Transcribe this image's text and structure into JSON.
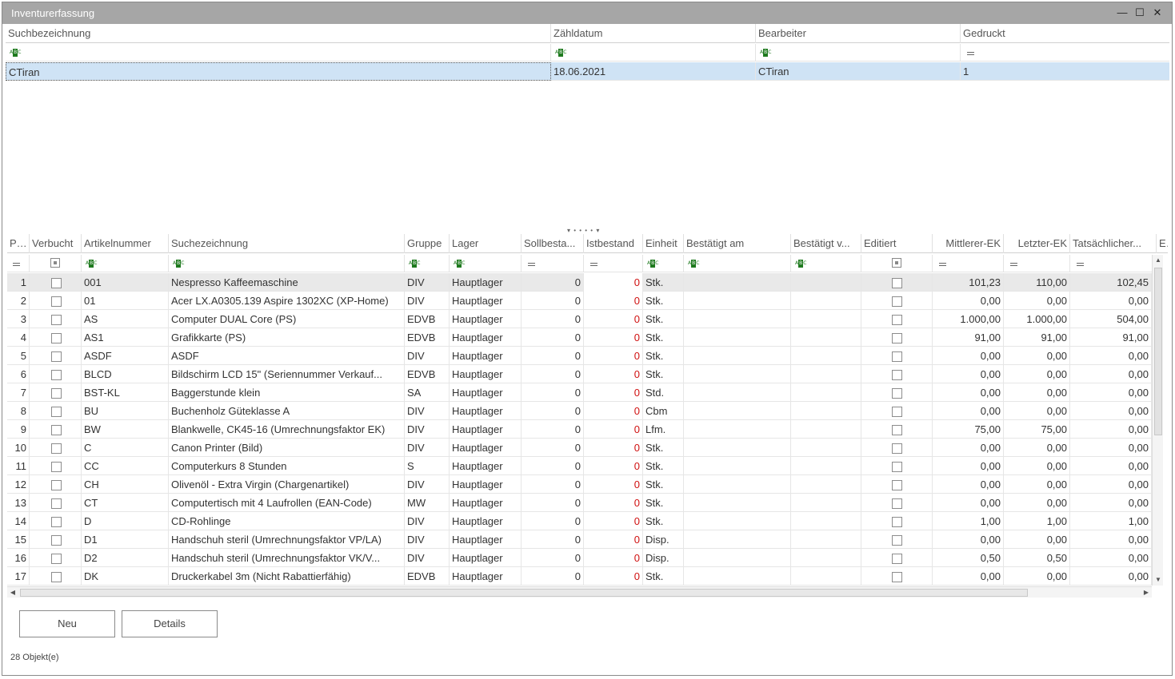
{
  "window": {
    "title": "Inventurerfassung",
    "minimize_glyph": "—",
    "maximize_glyph": "☐",
    "close_glyph": "✕"
  },
  "top_grid": {
    "columns": [
      "Suchbezeichnung",
      "Zähldatum",
      "Bearbeiter",
      "Gedruckt"
    ],
    "rows": [
      {
        "suchbezeichnung": "CTiran",
        "zaehldatum": "18.06.2021",
        "bearbeiter": "CTiran",
        "gedruckt": "1"
      }
    ]
  },
  "splitter_glyph": "▾ • • • • ▾",
  "bottom_grid": {
    "columns": [
      "Pos",
      "Verbucht",
      "Artikelnummer",
      "Suchezeichnung",
      "Gruppe",
      "Lager",
      "Sollbesta...",
      "Istbestand",
      "Einheit",
      "Bestätigt am",
      "Bestätigt v...",
      "Editiert",
      "Mittlerer-EK",
      "Letzter-EK",
      "Tatsächlicher...",
      "E"
    ],
    "rows": [
      {
        "pos": "1",
        "art": "001",
        "such": "Nespresso Kaffeemaschine",
        "gruppe": "DIV",
        "lager": "Hauptlager",
        "soll": "0",
        "ist": "0",
        "einheit": "Stk.",
        "mek": "101,23",
        "lek": "110,00",
        "tek": "102,45"
      },
      {
        "pos": "2",
        "art": "01",
        "such": "Acer LX.A0305.139 Aspire 1302XC (XP-Home)",
        "gruppe": "DIV",
        "lager": "Hauptlager",
        "soll": "0",
        "ist": "0",
        "einheit": "Stk.",
        "mek": "0,00",
        "lek": "0,00",
        "tek": "0,00"
      },
      {
        "pos": "3",
        "art": "AS",
        "such": "Computer DUAL Core (PS)",
        "gruppe": "EDVB",
        "lager": "Hauptlager",
        "soll": "0",
        "ist": "0",
        "einheit": "Stk.",
        "mek": "1.000,00",
        "lek": "1.000,00",
        "tek": "504,00"
      },
      {
        "pos": "4",
        "art": "AS1",
        "such": "Grafikkarte (PS)",
        "gruppe": "EDVB",
        "lager": "Hauptlager",
        "soll": "0",
        "ist": "0",
        "einheit": "Stk.",
        "mek": "91,00",
        "lek": "91,00",
        "tek": "91,00"
      },
      {
        "pos": "5",
        "art": "ASDF",
        "such": "ASDF",
        "gruppe": "DIV",
        "lager": "Hauptlager",
        "soll": "0",
        "ist": "0",
        "einheit": "Stk.",
        "mek": "0,00",
        "lek": "0,00",
        "tek": "0,00"
      },
      {
        "pos": "6",
        "art": "BLCD",
        "such": "Bildschirm LCD 15\" (Seriennummer Verkauf...",
        "gruppe": "EDVB",
        "lager": "Hauptlager",
        "soll": "0",
        "ist": "0",
        "einheit": "Stk.",
        "mek": "0,00",
        "lek": "0,00",
        "tek": "0,00"
      },
      {
        "pos": "7",
        "art": "BST-KL",
        "such": "Baggerstunde klein",
        "gruppe": "SA",
        "lager": "Hauptlager",
        "soll": "0",
        "ist": "0",
        "einheit": "Std.",
        "mek": "0,00",
        "lek": "0,00",
        "tek": "0,00"
      },
      {
        "pos": "8",
        "art": "BU",
        "such": "Buchenholz Güteklasse A",
        "gruppe": "DIV",
        "lager": "Hauptlager",
        "soll": "0",
        "ist": "0",
        "einheit": "Cbm",
        "mek": "0,00",
        "lek": "0,00",
        "tek": "0,00"
      },
      {
        "pos": "9",
        "art": "BW",
        "such": "Blankwelle, CK45-16 (Umrechnungsfaktor EK)",
        "gruppe": "DIV",
        "lager": "Hauptlager",
        "soll": "0",
        "ist": "0",
        "einheit": "Lfm.",
        "mek": "75,00",
        "lek": "75,00",
        "tek": "0,00"
      },
      {
        "pos": "10",
        "art": "C",
        "such": "Canon Printer (Bild)",
        "gruppe": "DIV",
        "lager": "Hauptlager",
        "soll": "0",
        "ist": "0",
        "einheit": "Stk.",
        "mek": "0,00",
        "lek": "0,00",
        "tek": "0,00"
      },
      {
        "pos": "11",
        "art": "CC",
        "such": "Computerkurs 8 Stunden",
        "gruppe": "S",
        "lager": "Hauptlager",
        "soll": "0",
        "ist": "0",
        "einheit": "Stk.",
        "mek": "0,00",
        "lek": "0,00",
        "tek": "0,00"
      },
      {
        "pos": "12",
        "art": "CH",
        "such": "Olivenöl - Extra Virgin (Chargenartikel)",
        "gruppe": "DIV",
        "lager": "Hauptlager",
        "soll": "0",
        "ist": "0",
        "einheit": "Stk.",
        "mek": "0,00",
        "lek": "0,00",
        "tek": "0,00"
      },
      {
        "pos": "13",
        "art": "CT",
        "such": "Computertisch mit 4 Laufrollen (EAN-Code)",
        "gruppe": "MW",
        "lager": "Hauptlager",
        "soll": "0",
        "ist": "0",
        "einheit": "Stk.",
        "mek": "0,00",
        "lek": "0,00",
        "tek": "0,00"
      },
      {
        "pos": "14",
        "art": "D",
        "such": "CD-Rohlinge",
        "gruppe": "DIV",
        "lager": "Hauptlager",
        "soll": "0",
        "ist": "0",
        "einheit": "Stk.",
        "mek": "1,00",
        "lek": "1,00",
        "tek": "1,00"
      },
      {
        "pos": "15",
        "art": "D1",
        "such": "Handschuh steril (Umrechnungsfaktor VP/LA)",
        "gruppe": "DIV",
        "lager": "Hauptlager",
        "soll": "0",
        "ist": "0",
        "einheit": "Disp.",
        "mek": "0,00",
        "lek": "0,00",
        "tek": "0,00"
      },
      {
        "pos": "16",
        "art": "D2",
        "such": "Handschuh steril (Umrechnungsfaktor VK/V...",
        "gruppe": "DIV",
        "lager": "Hauptlager",
        "soll": "0",
        "ist": "0",
        "einheit": "Disp.",
        "mek": "0,50",
        "lek": "0,50",
        "tek": "0,00"
      },
      {
        "pos": "17",
        "art": "DK",
        "such": "Druckerkabel 3m (Nicht Rabattierfähig)",
        "gruppe": "EDVB",
        "lager": "Hauptlager",
        "soll": "0",
        "ist": "0",
        "einheit": "Stk.",
        "mek": "0,00",
        "lek": "0,00",
        "tek": "0,00"
      }
    ]
  },
  "buttons": {
    "neu": "Neu",
    "details": "Details"
  },
  "status": "28 Objekt(e)",
  "colors": {
    "titlebar": "#a6a6a6",
    "selected_row": "#cfe3f5",
    "istbestand_red": "#d01010",
    "abc_icon": "#1e7a1e"
  }
}
